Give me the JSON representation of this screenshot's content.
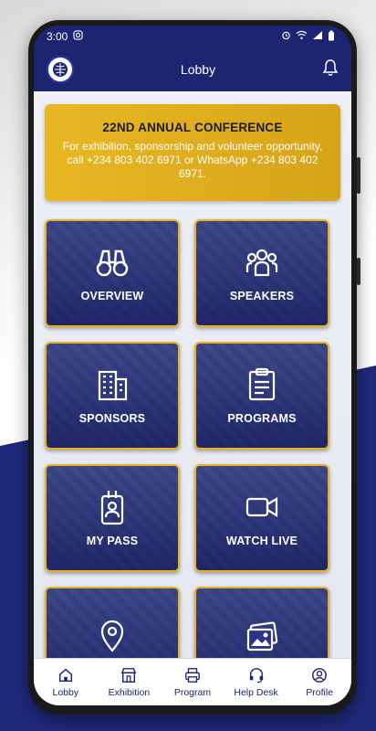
{
  "status_bar": {
    "time": "3:00"
  },
  "app_bar": {
    "title": "Lobby"
  },
  "banner": {
    "title": "22ND ANNUAL CONFERENCE",
    "body": "For exhibition, sponsorship and volunteer opportunity, call +234 803 402 6971 or WhatsApp +234 803 402 6971."
  },
  "tiles": [
    {
      "label": "OVERVIEW",
      "icon": "binoculars-icon"
    },
    {
      "label": "SPEAKERS",
      "icon": "people-group-icon"
    },
    {
      "label": "SPONSORS",
      "icon": "building-icon"
    },
    {
      "label": "PROGRAMS",
      "icon": "clipboard-list-icon"
    },
    {
      "label": "MY PASS",
      "icon": "id-badge-icon"
    },
    {
      "label": "WATCH LIVE",
      "icon": "video-camera-icon"
    },
    {
      "label": "",
      "icon": "location-pin-icon"
    },
    {
      "label": "",
      "icon": "image-gallery-icon"
    }
  ],
  "bottom_nav": [
    {
      "label": "Lobby",
      "icon": "home-icon"
    },
    {
      "label": "Exhibition",
      "icon": "storefront-icon"
    },
    {
      "label": "Program",
      "icon": "printer-icon"
    },
    {
      "label": "Help Desk",
      "icon": "headset-icon"
    },
    {
      "label": "Profile",
      "icon": "user-circle-icon"
    }
  ],
  "colors": {
    "primary": "#1d2573",
    "accent": "#e7b21e",
    "banner": "#e2ae1f"
  }
}
